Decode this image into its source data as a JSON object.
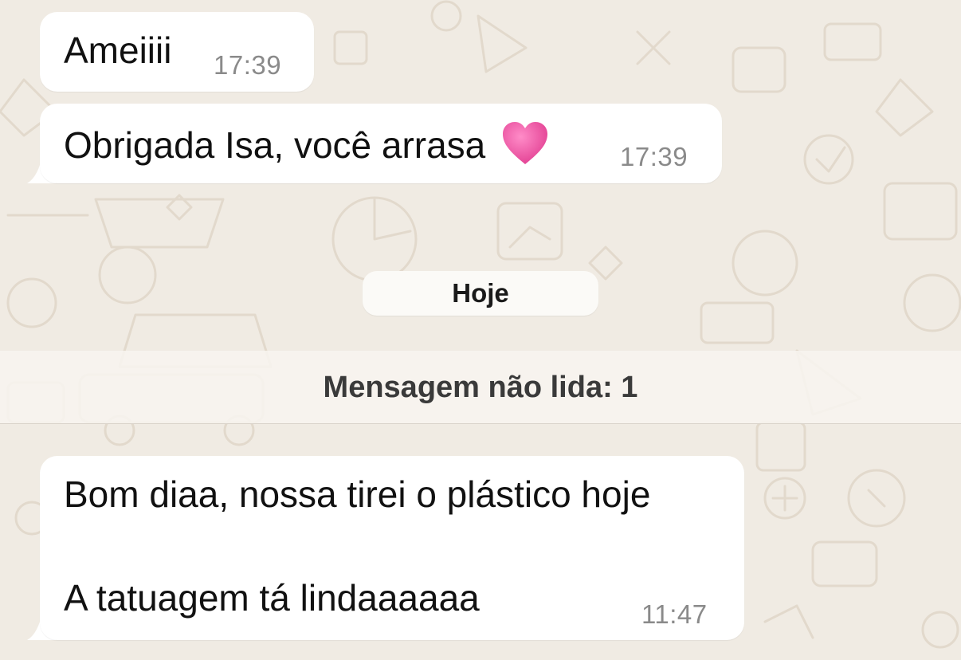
{
  "messages": [
    {
      "text": "Ameiiii",
      "time": "17:39"
    },
    {
      "text": "Obrigada Isa, você arrasa",
      "emoji": "pink-heart-icon",
      "time": "17:39"
    }
  ],
  "date_separator": "Hoje",
  "unread_banner": "Mensagem não lida: 1",
  "incoming": {
    "line1": "Bom diaa, nossa tirei o plástico hoje",
    "line2": "A tatuagem tá lindaaaaaa",
    "time": "11:47"
  },
  "colors": {
    "background": "#f0ebe3",
    "bubble": "#ffffff",
    "heart": "#e8449a"
  }
}
